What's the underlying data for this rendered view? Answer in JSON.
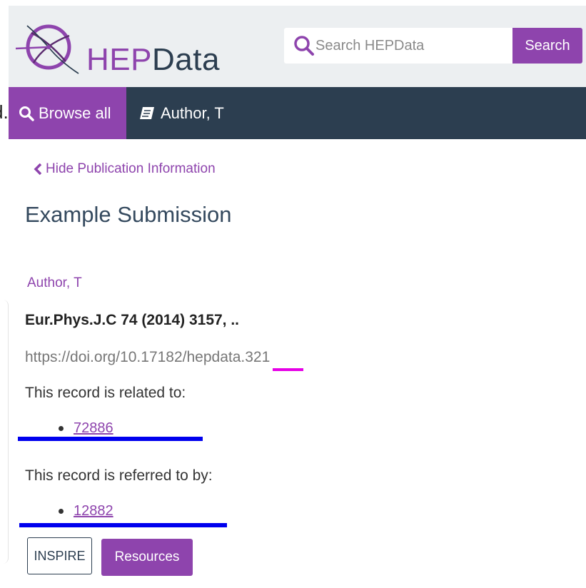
{
  "header": {
    "logo": {
      "hep": "HEP",
      "data": "Data"
    },
    "search": {
      "placeholder": "Search HEPData",
      "button_label": "Search"
    }
  },
  "nav": {
    "clipped_text": "d.",
    "browse_label": "Browse all",
    "author_label": "Author, T"
  },
  "record": {
    "hide_link": "Hide Publication Information",
    "title": "Example Submission",
    "author": "Author, T",
    "journal": "Eur.Phys.J.C 74 (2014) 3157, ..",
    "doi": "https://doi.org/10.17182/hepdata.321",
    "related_heading": "This record is related to:",
    "related": [
      "72886"
    ],
    "referred_heading": "This record is referred to by:",
    "referred": [
      "12882"
    ]
  },
  "buttons": {
    "inspire": "INSPIRE",
    "resources": "Resources"
  },
  "colors": {
    "accent": "#8e44ad",
    "navbar": "#2c3e50",
    "header_bg": "#eceff1",
    "annotation_blue": "#0000ee",
    "annotation_magenta": "#e600e6"
  },
  "icons": {
    "logo": "atom-circle-icon",
    "search": "search-icon",
    "browse": "search-icon",
    "author": "book-icon",
    "hide": "chevron-left-icon"
  }
}
